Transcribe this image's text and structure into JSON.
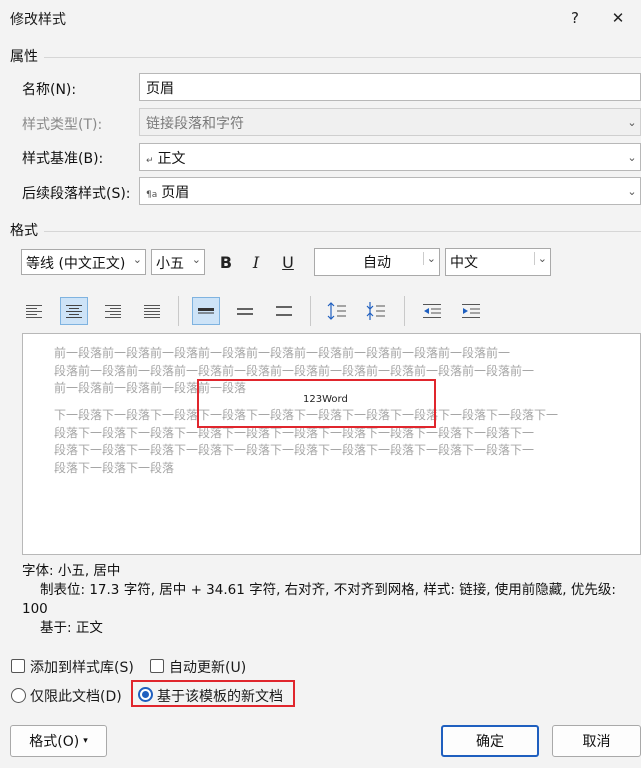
{
  "window": {
    "title": "修改样式",
    "help": "?",
    "close": "✕"
  },
  "properties": {
    "section_label": "属性",
    "name_label": "名称(N):",
    "name_value": "页眉",
    "type_label": "样式类型(T):",
    "type_value": "链接段落和字符",
    "base_label": "样式基准(B):",
    "base_value": "正文",
    "next_label": "后续段落样式(S):",
    "next_value": "页眉"
  },
  "format": {
    "section_label": "格式",
    "font": "等线 (中文正文)",
    "size": "小五",
    "bold": "B",
    "italic": "I",
    "underline": "U",
    "color": "自动",
    "script": "中文"
  },
  "preview": {
    "before_lines": [
      "前一段落前一段落前一段落前一段落前一段落前一段落前一段落前一段落前一段落前一",
      "段落前一段落前一段落前一段落前一段落前一段落前一段落前一段落前一段落前一段落前一",
      "前一段落前一段落前一段落前一段落"
    ],
    "sample_text": "123Word",
    "after_lines": [
      "下一段落下一段落下一段落下一段落下一段落下一段落下一段落下一段落下一段落下一段落下一",
      "段落下一段落下一段落下一段落下一段落下一段落下一段落下一段落下一段落下一段落下一",
      "段落下一段落下一段落下一段落下一段落下一段落下一段落下一段落下一段落下一段落下一",
      "段落下一段落下一段落"
    ]
  },
  "description": {
    "line1": "字体: 小五, 居中",
    "line2": "制表位: 17.3 字符, 居中 +  34.61 字符, 右对齐, 不对齐到网格, 样式: 链接, 使用前隐藏, 优先级:",
    "line3": "100",
    "line4": "基于: 正文"
  },
  "options": {
    "add_to_gallery": "添加到样式库(S)",
    "auto_update": "自动更新(U)",
    "only_this_doc": "仅限此文档(D)",
    "new_docs_template": "基于该模板的新文档"
  },
  "buttons": {
    "format": "格式(O)",
    "ok": "确定",
    "cancel": "取消"
  },
  "colors": {
    "accent": "#1f5fbf",
    "highlight_box": "#e0262d",
    "active_bg": "#cde3f7"
  }
}
